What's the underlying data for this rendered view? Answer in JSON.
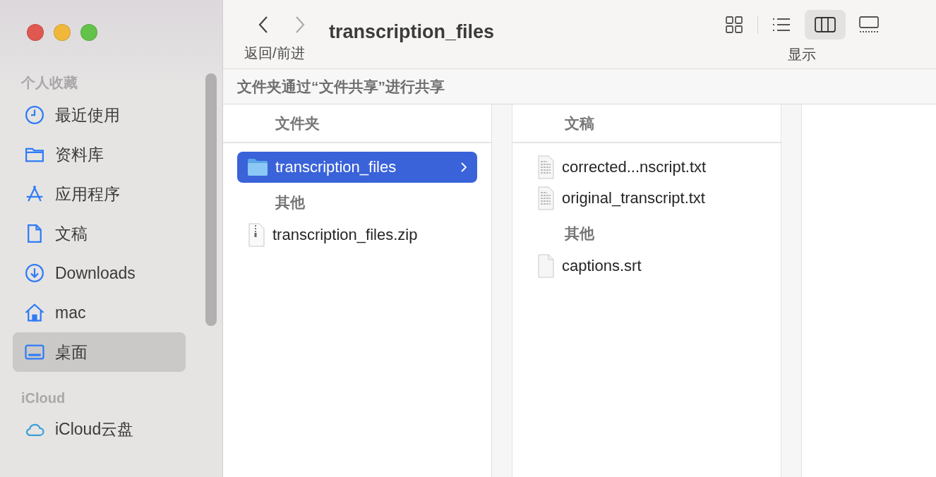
{
  "window": {
    "title": "transcription_files"
  },
  "toolbar": {
    "nav_label": "返回/前进",
    "view_label": "显示",
    "views": [
      {
        "kind": "icons",
        "selected": false
      },
      {
        "kind": "list",
        "selected": false
      },
      {
        "kind": "columns",
        "selected": true
      },
      {
        "kind": "gallery",
        "selected": false
      }
    ]
  },
  "sidebar": {
    "sections": [
      {
        "title": "个人收藏",
        "items": [
          {
            "kind": "clock",
            "label": "最近使用",
            "selected": false
          },
          {
            "kind": "folder",
            "label": "资料库",
            "selected": false
          },
          {
            "kind": "apps",
            "label": "应用程序",
            "selected": false
          },
          {
            "kind": "doc",
            "label": "文稿",
            "selected": false
          },
          {
            "kind": "download",
            "label": "Downloads",
            "selected": false
          },
          {
            "kind": "home",
            "label": "mac",
            "selected": false
          },
          {
            "kind": "desktop",
            "label": "桌面",
            "selected": true
          }
        ]
      },
      {
        "title": "iCloud",
        "items": [
          {
            "kind": "cloud",
            "label": "iCloud云盘",
            "selected": false
          }
        ]
      }
    ]
  },
  "share_bar": "文件夹通过“文件共享”进行共享",
  "columns": [
    {
      "header": "文件夹",
      "entries": [
        {
          "kind": "folder",
          "name": "transcription_files",
          "selected": true
        },
        {
          "kind": "section",
          "name": "其他"
        },
        {
          "kind": "zip",
          "name": "transcription_files.zip",
          "selected": false
        }
      ]
    },
    {
      "header": "文稿",
      "entries": [
        {
          "kind": "text",
          "name": "corrected...nscript.txt",
          "selected": false
        },
        {
          "kind": "text",
          "name": "original_transcript.txt",
          "selected": false
        },
        {
          "kind": "section",
          "name": "其他"
        },
        {
          "kind": "blank",
          "name": "captions.srt",
          "selected": false
        }
      ]
    }
  ]
}
